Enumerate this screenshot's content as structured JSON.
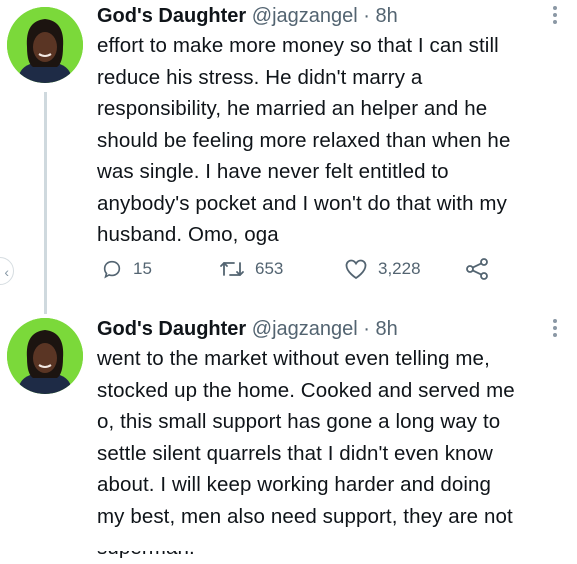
{
  "tweets": [
    {
      "author": {
        "name": "God's Daughter",
        "handle": "@jagzangel",
        "time": "· 8h"
      },
      "lines": [
        "effort to make more money so that I can still",
        "reduce his stress. He didn't marry a",
        "responsibility, he married an helper and he",
        "should be feeling more relaxed than when he",
        "was single. I have never felt entitled to",
        "anybody's pocket and I won't do that with my",
        "husband. Omo, oga"
      ],
      "actions": {
        "reply_count": "15",
        "retweet_count": "653",
        "like_count": "3,228"
      }
    },
    {
      "author": {
        "name": "God's Daughter",
        "handle": "@jagzangel",
        "time": "· 8h"
      },
      "lines": [
        "went to the market without even telling me,",
        "stocked up the home. Cooked and served me",
        "o, this small support has gone a long way to",
        "settle silent quarrels that I didn't even know",
        "about. I will keep working harder and doing",
        "my best, men also need support, they are not",
        "superman."
      ]
    }
  ],
  "icons": {
    "reply": "reply-icon",
    "retweet": "retweet-icon",
    "like": "heart-icon",
    "share": "share-icon",
    "more": "more-dots-icon",
    "nav": "chevron-left-icon"
  },
  "colors": {
    "text": "#0f1419",
    "secondary": "#536471",
    "thread_line": "#cfd9de",
    "avatar_bg": "#7bd93a"
  }
}
